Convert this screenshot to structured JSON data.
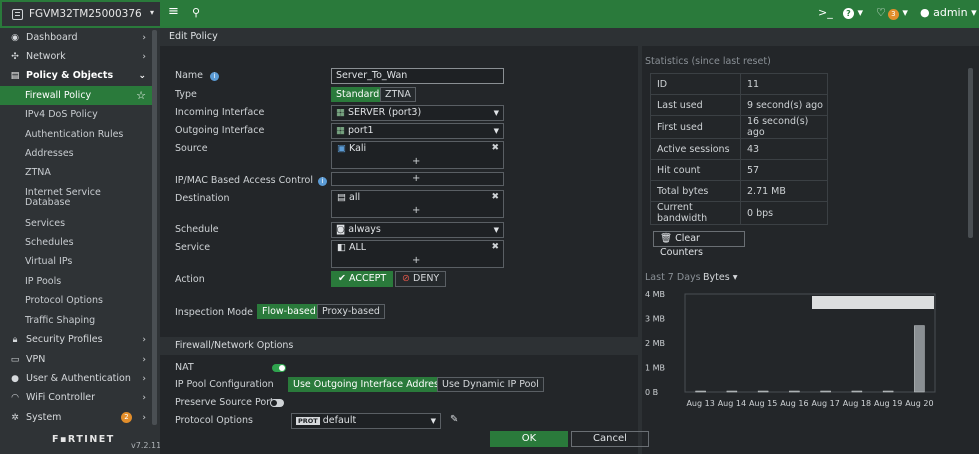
{
  "topbar": {
    "device": "FGVM32TM25000376",
    "cli": ">_",
    "help": "?",
    "bell_count": "3",
    "user": "admin"
  },
  "sidebar": {
    "items": [
      {
        "label": "Dashboard",
        "icon": "dashboard-icon"
      },
      {
        "label": "Network",
        "icon": "network-icon"
      },
      {
        "label": "Policy & Objects",
        "icon": "policy-icon"
      }
    ],
    "sub": [
      "Firewall Policy",
      "IPv4 DoS Policy",
      "Authentication Rules",
      "Addresses",
      "ZTNA",
      "Internet Service Database",
      "Services",
      "Schedules",
      "Virtual IPs",
      "IP Pools",
      "Protocol Options",
      "Traffic Shaping"
    ],
    "lower": [
      {
        "label": "Security Profiles",
        "icon": "lock-icon"
      },
      {
        "label": "VPN",
        "icon": "monitor-icon"
      },
      {
        "label": "User & Authentication",
        "icon": "user-icon"
      },
      {
        "label": "WiFi Controller",
        "icon": "wifi-icon"
      },
      {
        "label": "System",
        "icon": "gear-icon",
        "badge": "2"
      }
    ],
    "logo": "F▪RTINET",
    "version": "v7.2.11"
  },
  "edit_title": "Edit Policy",
  "form": {
    "name_label": "Name",
    "name_value": "Server_To_Wan",
    "type_label": "Type",
    "type_opts": [
      "Standard",
      "ZTNA"
    ],
    "incoming_label": "Incoming Interface",
    "incoming_value": "SERVER (port3)",
    "outgoing_label": "Outgoing Interface",
    "outgoing_value": "port1",
    "source_label": "Source",
    "source_value": "Kali",
    "ipmac_label": "IP/MAC Based Access Control",
    "dest_label": "Destination",
    "dest_value": "all",
    "schedule_label": "Schedule",
    "schedule_value": "always",
    "service_label": "Service",
    "service_value": "ALL",
    "action_label": "Action",
    "accept": "ACCEPT",
    "deny": "DENY",
    "inspection_label": "Inspection Mode",
    "inspection_opts": [
      "Flow-based",
      "Proxy-based"
    ],
    "section": "Firewall/Network Options",
    "nat_label": "NAT",
    "pool_label": "IP Pool Configuration",
    "pool_opts": [
      "Use Outgoing Interface Address",
      "Use Dynamic IP Pool"
    ],
    "preserve_label": "Preserve Source Port",
    "proto_label": "Protocol Options",
    "proto_tag": "PROT",
    "proto_value": "default"
  },
  "buttons": {
    "ok": "OK",
    "cancel": "Cancel"
  },
  "stats": {
    "title": "Statistics (since last reset)",
    "rows": [
      [
        "ID",
        "11"
      ],
      [
        "Last used",
        "9 second(s) ago"
      ],
      [
        "First used",
        "16 second(s) ago"
      ],
      [
        "Active sessions",
        "43"
      ],
      [
        "Hit count",
        "57"
      ],
      [
        "Total bytes",
        "2.71 MB"
      ],
      [
        "Current bandwidth",
        "0 bps"
      ]
    ],
    "clear": "Clear Counters"
  },
  "chart_data": {
    "type": "bar",
    "title": "Last 7 Days",
    "unit_selector": "Bytes",
    "categories": [
      "Aug 13",
      "Aug 14",
      "Aug 15",
      "Aug 16",
      "Aug 17",
      "Aug 18",
      "Aug 19",
      "Aug 20"
    ],
    "values": [
      0,
      0,
      0,
      0,
      0,
      0,
      0,
      2.71
    ],
    "y_ticks": [
      "0 B",
      "1 MB",
      "2 MB",
      "3 MB",
      "4 MB"
    ],
    "ylim": [
      0,
      4
    ],
    "color": "#8a8f93"
  }
}
